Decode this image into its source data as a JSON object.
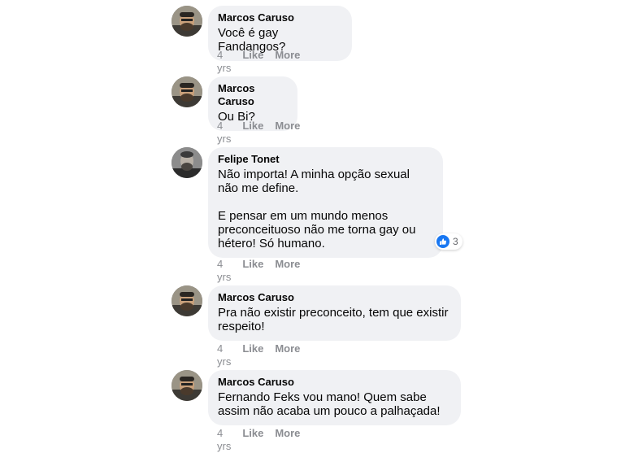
{
  "comments": [
    {
      "author": "Marcos Caruso",
      "text": [
        "Você é gay Fandangos?"
      ],
      "time": "4 yrs",
      "like": "Like",
      "more": "More"
    },
    {
      "author": "Marcos Caruso",
      "text": [
        "Ou Bi?"
      ],
      "time": "4 yrs",
      "like": "Like",
      "more": "More"
    },
    {
      "author": "Felipe Tonet",
      "text": [
        "Não importa! A minha opção sexual não me define.",
        "E pensar em um mundo menos preconceituoso não me torna gay ou hétero! Só humano."
      ],
      "time": "4 yrs",
      "like": "Like",
      "more": "More",
      "reaction": {
        "icon": "thumbs-up-icon",
        "count": "3",
        "color": "#1877f2"
      }
    },
    {
      "author": "Marcos Caruso",
      "text": [
        "Pra não existir preconceito, tem que existir respeito!"
      ],
      "time": "4 yrs",
      "like": "Like",
      "more": "More"
    },
    {
      "author": "Marcos Caruso",
      "text": [
        "Fernando Feks vou mano! Quem sabe assim não acaba um pouco a palhaçada!"
      ],
      "time": "4 yrs",
      "like": "Like",
      "more": "More"
    }
  ]
}
